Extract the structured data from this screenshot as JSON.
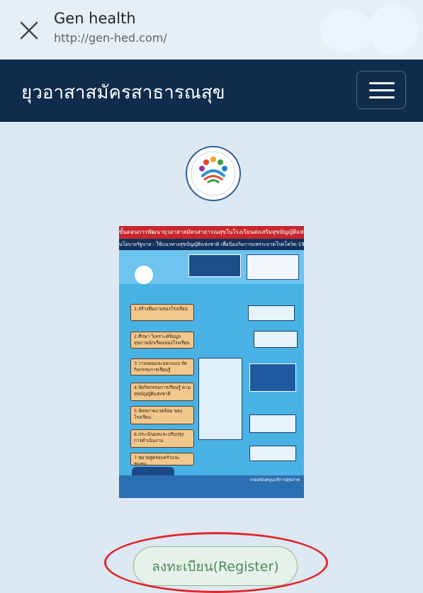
{
  "browser": {
    "title": "Gen health",
    "url": "http://gen-hed.com/"
  },
  "navbar": {
    "brand": "ยุวอาสาสมัครสาธารณสุข"
  },
  "logo": {
    "text": "ยุวอาสาสมัครสาธารณสุข"
  },
  "poster": {
    "title": "ขั้นตอนการพัฒนายุวอาสาสมัครสาธารณสุขในโรงเรียนส่งเสริมสุขบัญญัติแห่งชาติ",
    "policy": "นโยบายรัฐบาล : ใช้แนวทางสุขบัญญัติแห่งชาติ เพื่อป้องกันการแพร่ระบาดโรคโควิด-19",
    "steps": [
      "1.สร้างทีมงานของโรงเรียน",
      "2.ศึกษา วิเคราะห์ข้อมูล สุขภาพนักเรียนของโรงเรียน",
      "3.วางแผนและออกแบบ จัดกิจกรรมการเรียนรู้",
      "4.จัดกิจกรรมการเรียนรู้ ตามสุขบัญญัติแห่งชาติ",
      "5.จัดสภาพแวดล้อม ของโรงเรียน",
      "6.ประเมินผลและปรับปรุง การดำเนินงาน",
      "7.ขยายสู่ครอบครัวและชุมชน"
    ],
    "footer": "กรมสนับสนุนบริการสุขภาพ"
  },
  "register": {
    "label": "ลงทะเบียน(Register)"
  },
  "colors": {
    "navbar": "#0f2c4c",
    "page_bg": "#dde9f2",
    "register_text": "#4c8a5a",
    "highlight": "#e3262c"
  }
}
